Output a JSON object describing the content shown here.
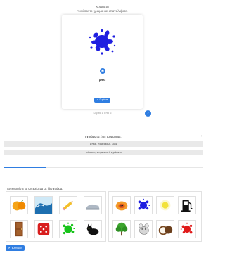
{
  "header": {
    "title": "Χρώματα",
    "subtitle": "Ακούστε το χρώμα και επαναλάβετε."
  },
  "card": {
    "image_icon": "blue-paint-splash",
    "word": "μπλε",
    "hint_label": "✔ Γυρίστε"
  },
  "pager": {
    "counter": "Κάρτα 1 από 6"
  },
  "question": {
    "text": "Τι χρώματα έχει το φανάρι;",
    "options": [
      "μπλε, πορτοκαλί, μωβ",
      "κόκκινο, πορτοκαλί, πράσινο"
    ]
  },
  "progress": {
    "fraction": 0.21
  },
  "match": {
    "instruction": "Αντιστοιχίστε τα αντικείμενα με ίδιο χρώμα.",
    "left_items": [
      "orange-fruit",
      "wave",
      "pencil",
      "sneakers",
      "wooden-door",
      "red-dice",
      "green-splash",
      "black-cat"
    ],
    "right_items": [
      "papaya",
      "blue-splash",
      "yellow-sun",
      "fuel-pump",
      "green-tree",
      "grey-mouse",
      "coconut",
      "red-splash"
    ]
  },
  "check_label": "✔ Έλεγχος",
  "colors": {
    "accent": "#2f7de1",
    "splash_blue": "#1f1fe0"
  }
}
